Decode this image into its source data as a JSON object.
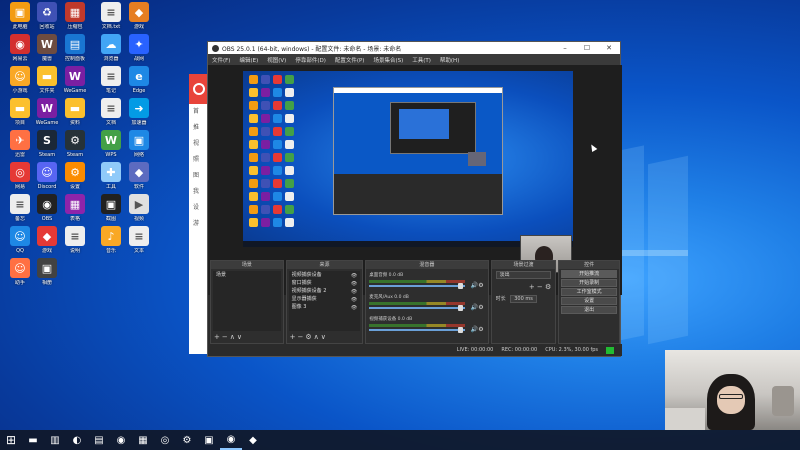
{
  "obs": {
    "title": "OBS 25.0.1 (64-bit, windows) - 配置文件: 未命名 - 场景: 未命名",
    "menu": [
      "文件(F)",
      "编辑(E)",
      "视图(V)",
      "停靠部件(D)",
      "配置文件(P)",
      "场景集合(S)",
      "工具(T)",
      "帮助(H)"
    ],
    "docks": {
      "scenes_title": "场景",
      "scenes": [
        "场景"
      ],
      "sources_title": "来源",
      "sources": [
        "视频捕获设备",
        "窗口捕获",
        "视频捕获设备 2",
        "显示器捕获",
        "图像 3"
      ],
      "mixer_title": "混音器",
      "mixer": [
        {
          "name": "桌面音频",
          "level": "0.0 dB"
        },
        {
          "name": "麦克风/Aux",
          "level": "0.0 dB"
        },
        {
          "name": "视频捕获设备",
          "level": "0.0 dB"
        }
      ],
      "transitions_title": "场景过渡",
      "transition_select": "淡出",
      "duration_label": "时长",
      "duration_value": "300 ms",
      "controls_title": "控件",
      "controls": [
        "开始推流",
        "开始录制",
        "工作室模式",
        "设置",
        "退出"
      ]
    },
    "status": {
      "live": "LIVE: 00:00:00",
      "rec": "REC: 00:00:00",
      "cpu": "CPU: 2.3%, 30.00 fps"
    }
  },
  "side_app": {
    "items": [
      "首",
      "推",
      "视",
      "照",
      "图",
      "我",
      "设",
      "游"
    ]
  },
  "desktop_icons": [
    {
      "label": "此电脑",
      "color": "#f39c12",
      "glyph": "▣"
    },
    {
      "label": "回收站",
      "color": "#3f51b5",
      "glyph": "♻"
    },
    {
      "label": "压缩包",
      "color": "#c0392b",
      "glyph": "▦"
    },
    {
      "label": "文档.txt",
      "color": "#eeeeee",
      "glyph": "≡"
    },
    {
      "label": "游戏",
      "color": "#e67e22",
      "glyph": "◆"
    },
    {
      "label": "网易云",
      "color": "#d32f2f",
      "glyph": "◉"
    },
    {
      "label": "魔兽",
      "color": "#6d4c41",
      "glyph": "W"
    },
    {
      "label": "控制面板",
      "color": "#1976d2",
      "glyph": "▤"
    },
    {
      "label": "浏览器",
      "color": "#42a5f5",
      "glyph": "☁"
    },
    {
      "label": "战网",
      "color": "#2962ff",
      "glyph": "✦"
    },
    {
      "label": "小游戏",
      "color": "#f9a825",
      "glyph": "☺"
    },
    {
      "label": "文件夹",
      "color": "#fbc02d",
      "glyph": "▬"
    },
    {
      "label": "WeGame",
      "color": "#7b1fa2",
      "glyph": "W"
    },
    {
      "label": "笔记",
      "color": "#eeeeee",
      "glyph": "≡"
    },
    {
      "label": "Edge",
      "color": "#1e88e5",
      "glyph": "e"
    },
    {
      "label": "项目",
      "color": "#fbc02d",
      "glyph": "▬"
    },
    {
      "label": "WeGame",
      "color": "#7b1fa2",
      "glyph": "W"
    },
    {
      "label": "资料",
      "color": "#fbc02d",
      "glyph": "▬"
    },
    {
      "label": "文档",
      "color": "#eeeeee",
      "glyph": "≡"
    },
    {
      "label": "加速器",
      "color": "#039be5",
      "glyph": "➜"
    },
    {
      "label": "迅雷",
      "color": "#ff7043",
      "glyph": "✈"
    },
    {
      "label": "Steam",
      "color": "#1b2838",
      "glyph": "S"
    },
    {
      "label": "Steam",
      "color": "#263238",
      "glyph": "⚙"
    },
    {
      "label": "WPS",
      "color": "#43a047",
      "glyph": "W"
    },
    {
      "label": "网络",
      "color": "#1e88e5",
      "glyph": "▣"
    },
    {
      "label": "网易",
      "color": "#e53935",
      "glyph": "◎"
    },
    {
      "label": "Discord",
      "color": "#5865f2",
      "glyph": "☺"
    },
    {
      "label": "设置",
      "color": "#fb8c00",
      "glyph": "⚙"
    },
    {
      "label": "工具",
      "color": "#90caf9",
      "glyph": "✚"
    },
    {
      "label": "软件",
      "color": "#5c6bc0",
      "glyph": "◆"
    },
    {
      "label": "备忘",
      "color": "#eeeeee",
      "glyph": "≡"
    },
    {
      "label": "OBS",
      "color": "#222222",
      "glyph": "◉"
    },
    {
      "label": "表格",
      "color": "#8e24aa",
      "glyph": "▦"
    },
    {
      "label": "截图",
      "color": "#212121",
      "glyph": "▣"
    },
    {
      "label": "视频",
      "color": "#e0e0e0",
      "glyph": "▶"
    },
    {
      "label": "QQ",
      "color": "#1e88e5",
      "glyph": "☺"
    },
    {
      "label": "游戏",
      "color": "#e53935",
      "glyph": "◆"
    },
    {
      "label": "说明",
      "color": "#eeeeee",
      "glyph": "≡"
    },
    {
      "label": "音乐",
      "color": "#f9a825",
      "glyph": "♪"
    },
    {
      "label": "文本",
      "color": "#eeeeee",
      "glyph": "≡"
    },
    {
      "label": "助手",
      "color": "#ff7043",
      "glyph": "☺"
    },
    {
      "label": "相册",
      "color": "#424242",
      "glyph": "▣"
    }
  ],
  "taskbar": {
    "items": [
      {
        "name": "start-button",
        "glyph": "⊞"
      },
      {
        "name": "taskbar-explorer",
        "glyph": "▬"
      },
      {
        "name": "taskbar-app-1",
        "glyph": "▥"
      },
      {
        "name": "taskbar-edge",
        "glyph": "◐"
      },
      {
        "name": "taskbar-app-2",
        "glyph": "▤"
      },
      {
        "name": "taskbar-app-3",
        "glyph": "◉"
      },
      {
        "name": "taskbar-app-4",
        "glyph": "▦"
      },
      {
        "name": "taskbar-wangyiyun",
        "glyph": "◎"
      },
      {
        "name": "taskbar-steam",
        "glyph": "⚙"
      },
      {
        "name": "taskbar-app-5",
        "glyph": "▣"
      },
      {
        "name": "taskbar-obs",
        "glyph": "◉"
      },
      {
        "name": "taskbar-app-6",
        "glyph": "◆"
      }
    ]
  }
}
